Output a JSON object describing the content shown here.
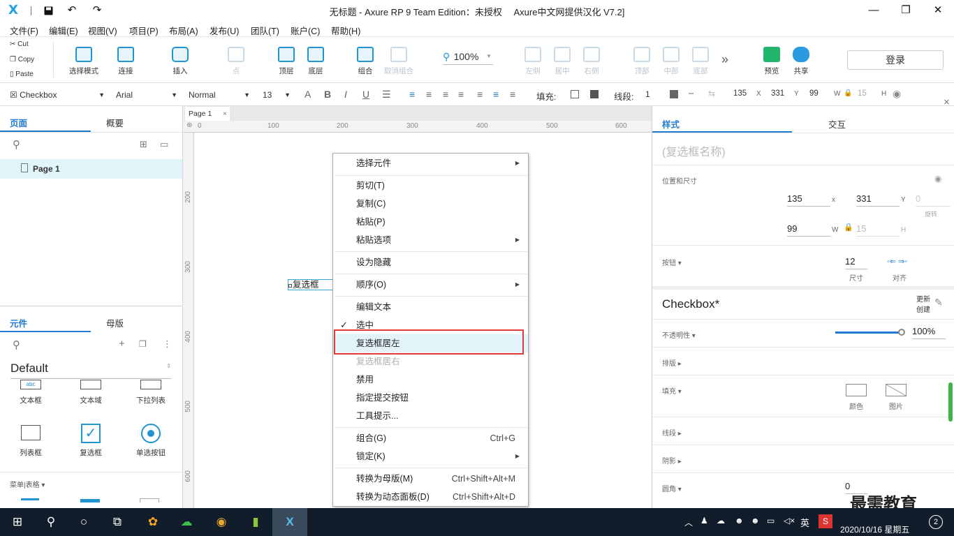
{
  "window": {
    "title": "无标题 - Axure RP 9 Team Edition：未授权　 Axure中文网提供汉化 V7.2]",
    "logo": "X",
    "min": "—",
    "max": "❐",
    "close": "✕",
    "save_icon": "save-icon",
    "undo_icon": "undo-icon",
    "redo_icon": "redo-icon"
  },
  "menu": [
    "文件(F)",
    "编辑(E)",
    "视图(V)",
    "项目(P)",
    "布局(A)",
    "发布(U)",
    "团队(T)",
    "账户(C)",
    "帮助(H)"
  ],
  "clipboard": {
    "cut": "Cut",
    "copy": "Copy",
    "paste": "Paste"
  },
  "tools": {
    "select": "选择模式",
    "connect": "连接",
    "insert": "插入",
    "point": "点",
    "top": "顶层",
    "bottom": "底层",
    "group": "组合",
    "ungroup": "取消组合",
    "zoom": "100%",
    "left": "左侧",
    "center": "居中",
    "right": "右侧",
    "topalign": "顶部",
    "middle": "中部",
    "bottomalign": "底部",
    "more": "»",
    "preview": "预览",
    "share": "共享",
    "login": "登录"
  },
  "format": {
    "widget": "Checkbox",
    "font": "Arial",
    "style": "Normal",
    "size": "13",
    "fill_label": "填充:",
    "stroke_label": "线段:",
    "stroke_val": "1",
    "x": "135",
    "x_label": "X",
    "y": "331",
    "y_label": "Y",
    "w": "99",
    "w_label": "W",
    "h": "15",
    "h_label": "H"
  },
  "pages": {
    "tab_pages": "页面",
    "tab_outline": "概要",
    "page_item": "Page 1"
  },
  "library": {
    "tab_widgets": "元件",
    "tab_masters": "母版",
    "lib_name": "Default",
    "items": [
      "文本框",
      "文本域",
      "下拉列表",
      "列表框",
      "复选框",
      "单选按钮"
    ],
    "section": "菜单|表格 ▾"
  },
  "canvas": {
    "tab": "Page 1",
    "tab_close": "×",
    "ruler_top": [
      "0",
      "100",
      "200",
      "300",
      "400",
      "500",
      "600"
    ],
    "ruler_left": [
      "200",
      "300",
      "400",
      "500",
      "600"
    ],
    "checkbox_label": "复选框"
  },
  "context_menu": {
    "items": [
      {
        "label": "选择元件",
        "shortcut": "",
        "arrow": "▶",
        "disabled": false
      },
      {
        "label": "剪切(T)",
        "shortcut": "",
        "arrow": "",
        "disabled": false
      },
      {
        "label": "复制(C)",
        "shortcut": "",
        "arrow": "",
        "disabled": false
      },
      {
        "label": "粘贴(P)",
        "shortcut": "",
        "arrow": "",
        "disabled": false
      },
      {
        "label": "粘贴选项",
        "shortcut": "",
        "arrow": "▶",
        "disabled": false
      },
      {
        "label": "设为隐藏",
        "shortcut": "",
        "arrow": "",
        "disabled": false
      },
      {
        "label": "顺序(O)",
        "shortcut": "",
        "arrow": "▶",
        "disabled": false
      },
      {
        "label": "编辑文本",
        "shortcut": "",
        "arrow": "",
        "disabled": false
      },
      {
        "label": "选中",
        "shortcut": "",
        "arrow": "",
        "disabled": false,
        "checked": "✓"
      },
      {
        "label": "复选框居左",
        "shortcut": "",
        "arrow": "",
        "disabled": false,
        "highlight": true
      },
      {
        "label": "复选框居右",
        "shortcut": "",
        "arrow": "",
        "disabled": true
      },
      {
        "label": "禁用",
        "shortcut": "",
        "arrow": "",
        "disabled": false
      },
      {
        "label": "指定提交按钮",
        "shortcut": "",
        "arrow": "",
        "disabled": false
      },
      {
        "label": "工具提示...",
        "shortcut": "",
        "arrow": "",
        "disabled": false
      },
      {
        "label": "组合(G)",
        "shortcut": "Ctrl+G",
        "arrow": "",
        "disabled": false
      },
      {
        "label": "锁定(K)",
        "shortcut": "",
        "arrow": "▶",
        "disabled": false
      },
      {
        "label": "转换为母版(M)",
        "shortcut": "Ctrl+Shift+Alt+M",
        "arrow": "",
        "disabled": false
      },
      {
        "label": "转换为动态面板(D)",
        "shortcut": "Ctrl+Shift+Alt+D",
        "arrow": "",
        "disabled": false
      }
    ]
  },
  "inspector": {
    "tab_style": "样式",
    "tab_interact": "交互",
    "name_placeholder": "(复选框名称)",
    "pos_size": "位置和尺寸",
    "x": "135",
    "x_label": "x",
    "y": "331",
    "y_label": "Y",
    "rot": "0",
    "rot_label": "旋转",
    "w": "99",
    "w_label": "W",
    "h": "15",
    "h_label": "H",
    "button": "按钮 ▾",
    "btn_size": "12",
    "btn_size_label": "尺寸",
    "btn_align_label": "对齐",
    "style_name": "Checkbox*",
    "update": "更新",
    "create": "创建",
    "opacity": "不透明性 ▾",
    "opacity_val": "100%",
    "typography": "排版 ▸",
    "fill": "填充 ▾",
    "fill_color": "颜色",
    "fill_image": "图片",
    "stroke": "线段 ▸",
    "shadow": "阴影 ▸",
    "corner": "圆角 ▾",
    "corner_val": "0"
  },
  "taskbar": {
    "ime": "英",
    "datetime": "2020/10/16 星期五",
    "notif": "2",
    "watermark": "最需教育"
  }
}
